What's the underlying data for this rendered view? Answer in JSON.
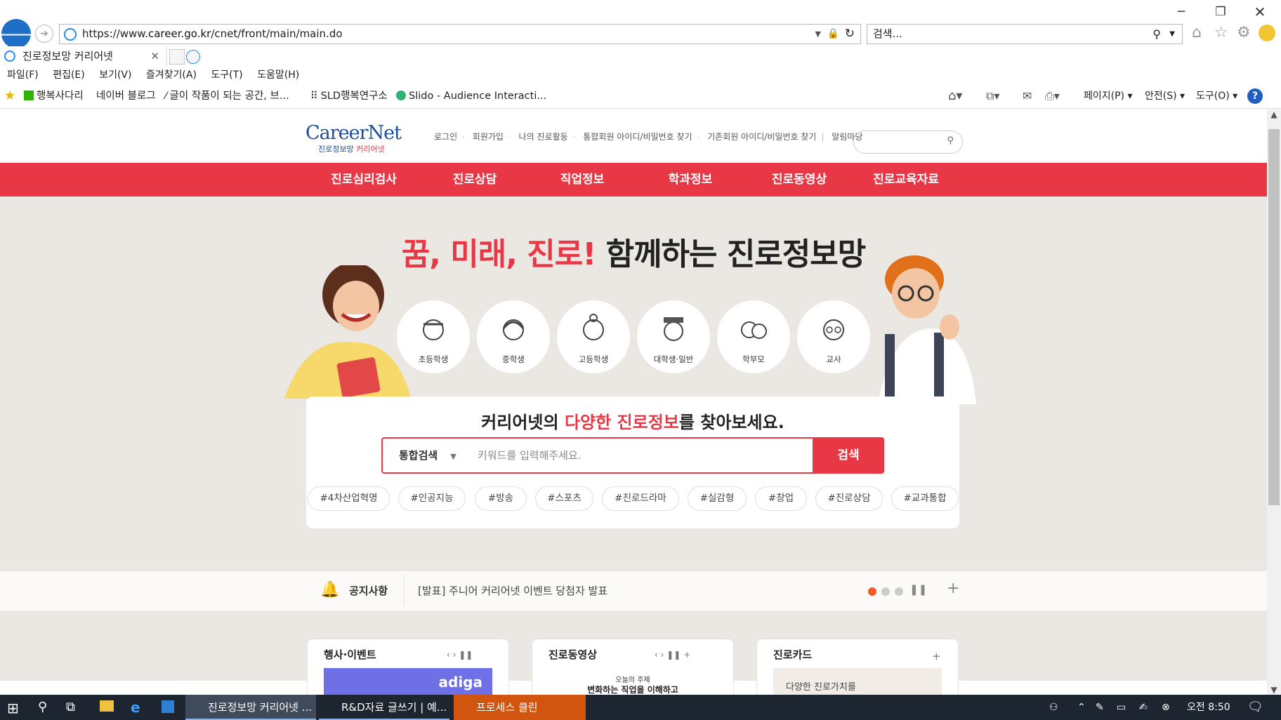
{
  "browser": {
    "url_prefix": "https://www.",
    "url_domain": "career.go.kr",
    "url_path": "/cnet/front/main/main.do",
    "search_placeholder": "검색...",
    "tab_title": "진로정보망 커리어넷",
    "menu": [
      "파일(F)",
      "편집(E)",
      "보기(V)",
      "즐겨찾기(A)",
      "도구(T)",
      "도움말(H)"
    ],
    "favorites": [
      "행복사다리",
      "네이버 블로그",
      "글이 작품이 되는 공간, 브...",
      "SLD행복연구소",
      "Slido - Audience Interacti..."
    ],
    "commands": [
      "페이지(P)",
      "안전(S)",
      "도구(O)"
    ]
  },
  "site": {
    "logo_main": "CareerNet",
    "logo_sub_a": "진로정보망",
    "logo_sub_b": "커리어넷",
    "util_links": [
      "로그인",
      "회원가입",
      "나의 진로활동",
      "통합회원 아이디/비밀번호 찾기",
      "기존회원 아이디/비밀번호 찾기",
      "알림마당"
    ],
    "gnb": [
      "진로심리검사",
      "진로상담",
      "직업정보",
      "학과정보",
      "진로동영상",
      "진로교육자료"
    ],
    "hero": {
      "title_red": "꿈, 미래, 진로!",
      "title_rest": " 함께하는 진로정보망",
      "targets": [
        "초등학생",
        "중학생",
        "고등학생",
        "대학생·일반",
        "학부모",
        "교사"
      ]
    },
    "search": {
      "title_a": "커리어넷의 ",
      "title_red": "다양한 진로정보",
      "title_b": "를 찾아보세요.",
      "select": "통합검색",
      "placeholder": "키워드를 입력해주세요.",
      "button": "검색",
      "tags": [
        "#4차산업혁명",
        "#인공지능",
        "#방송",
        "#스포츠",
        "#진로드라마",
        "#실감형",
        "#창업",
        "#진로상담",
        "#교과통합"
      ]
    },
    "notice": {
      "label": "공지사항",
      "text": "[발표] 주니어 커리어넷 이벤트 당첨자 발표"
    },
    "cards": [
      {
        "title": "행사·이벤트",
        "banner": "adiga"
      },
      {
        "title": "진로동영상",
        "sub1": "오늘의 주제",
        "sub2": "변화하는 직업을 이해하고"
      },
      {
        "title": "진로카드",
        "sub1": "다양한 진로가치를"
      }
    ]
  },
  "taskbar": {
    "apps": [
      "진로정보망 커리어넷 ...",
      "R&D자료 글쓰기 | 예...",
      "프로세스 클린"
    ],
    "time": "오전 8:50"
  },
  "colors": {
    "accent": "#e93845",
    "brand_blue": "#1e4d99",
    "hero_bg": "#ebe8e4",
    "taskbar": "#1d2530"
  }
}
